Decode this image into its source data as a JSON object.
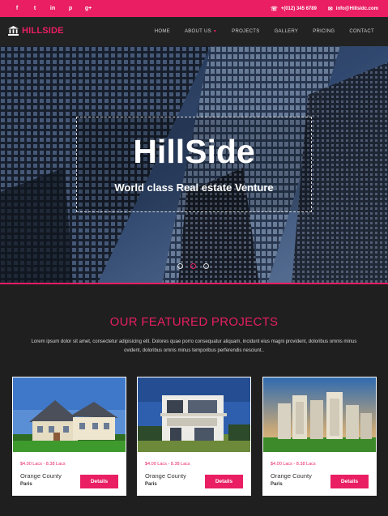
{
  "topbar": {
    "social": [
      {
        "icon": "facebook-icon",
        "glyph": "f"
      },
      {
        "icon": "twitter-icon",
        "glyph": "t"
      },
      {
        "icon": "linkedin-icon",
        "glyph": "in"
      },
      {
        "icon": "pinterest-icon",
        "glyph": "p"
      },
      {
        "icon": "google-plus-icon",
        "glyph": "g+"
      }
    ],
    "phone": "+(012) 345 6789",
    "email": "info@Hillsidc.com"
  },
  "nav": {
    "logo": "HILLSIDE",
    "items": [
      "HOME",
      "ABOUT US",
      "PROJECTS",
      "GALLERY",
      "PRICING",
      "CONTACT"
    ]
  },
  "hero": {
    "title": "HillSide",
    "subtitle": "World class Real estate Venture"
  },
  "featured": {
    "title": "OUR FEATURED PROJECTS",
    "description": "Lorem ipsum dolor sit amet, consectetur adipisicing elit. Dolores quae porro consequatur aliquam, incidunt eius magni provident, doloribus omnis minus ovident, doloribus omnis minus temporibus perferendis nesciunt..",
    "cards": [
      {
        "price": "$4.00 Lacs - 8.38 Lacs",
        "name": "Orange County",
        "city": "Paris",
        "button": "Details"
      },
      {
        "price": "$4.00 Lacs - 8.38 Lacs",
        "name": "Orange County",
        "city": "Paris",
        "button": "Details"
      },
      {
        "price": "$4.00 Lacs - 8.38 Lacs",
        "name": "Orange County",
        "city": "Paris",
        "button": "Details"
      }
    ]
  },
  "colors": {
    "accent": "#e91e63",
    "dark": "#1f1f1f",
    "nav": "#222222"
  }
}
